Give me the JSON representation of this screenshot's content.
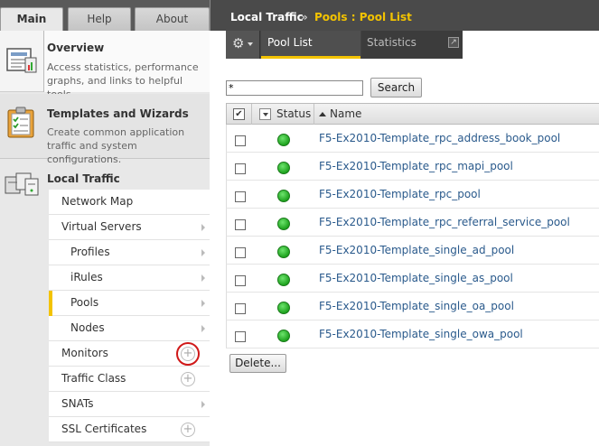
{
  "tabs": {
    "main": "Main",
    "help": "Help",
    "about": "About"
  },
  "overview": {
    "title": "Overview",
    "description": "Access statistics, performance graphs, and links to helpful tools."
  },
  "templates": {
    "title": "Templates and Wizards",
    "description": "Create common application traffic and system configurations."
  },
  "local_traffic": {
    "title": "Local Traffic",
    "items": [
      {
        "label": "Network Map",
        "arrow": false,
        "plus": false
      },
      {
        "label": "Virtual Servers",
        "arrow": true,
        "plus": false
      },
      {
        "label": "Profiles",
        "arrow": true,
        "plus": false,
        "sub": true
      },
      {
        "label": "iRules",
        "arrow": true,
        "plus": false,
        "sub": true
      },
      {
        "label": "Pools",
        "arrow": true,
        "plus": false,
        "sub": true,
        "selected": true
      },
      {
        "label": "Nodes",
        "arrow": true,
        "plus": false,
        "sub": true
      },
      {
        "label": "Monitors",
        "arrow": false,
        "plus": true,
        "highlighted": true
      },
      {
        "label": "Traffic Class",
        "arrow": false,
        "plus": true
      },
      {
        "label": "SNATs",
        "arrow": true,
        "plus": false
      },
      {
        "label": "SSL Certificates",
        "arrow": false,
        "plus": true
      }
    ]
  },
  "breadcrumb": {
    "section": "Local Traffic",
    "separator": "»",
    "current": "Pools : Pool List"
  },
  "toolbar": {
    "tabs": [
      "Pool List",
      "Statistics"
    ],
    "active_tab": "Pool List"
  },
  "search": {
    "value": "*",
    "button": "Search"
  },
  "table": {
    "columns": {
      "status": "Status",
      "name": "Name"
    },
    "rows": [
      {
        "name": "F5-Ex2010-Template_rpc_address_book_pool",
        "status": "available"
      },
      {
        "name": "F5-Ex2010-Template_rpc_mapi_pool",
        "status": "available"
      },
      {
        "name": "F5-Ex2010-Template_rpc_pool",
        "status": "available"
      },
      {
        "name": "F5-Ex2010-Template_rpc_referral_service_pool",
        "status": "available"
      },
      {
        "name": "F5-Ex2010-Template_single_ad_pool",
        "status": "available"
      },
      {
        "name": "F5-Ex2010-Template_single_as_pool",
        "status": "available"
      },
      {
        "name": "F5-Ex2010-Template_single_oa_pool",
        "status": "available"
      },
      {
        "name": "F5-Ex2010-Template_single_owa_pool",
        "status": "available"
      }
    ]
  },
  "delete_button": "Delete...",
  "colors": {
    "accent": "#f3c300",
    "header_bg": "#4a4a4a",
    "link": "#2a5a8c",
    "status_green": "#1fa31f",
    "highlight_red": "#d01919"
  }
}
